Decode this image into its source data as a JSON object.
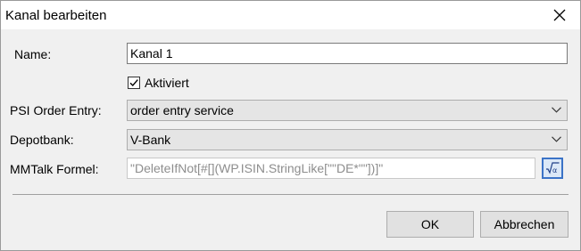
{
  "dialog": {
    "title": "Kanal bearbeiten",
    "close_icon": "close-icon"
  },
  "form": {
    "name_label": "Name:",
    "name_value": "Kanal 1",
    "aktiviert_label": "Aktiviert",
    "aktiviert_checked": true,
    "psi_label": "PSI Order Entry:",
    "psi_value": "order entry service",
    "depotbank_label": "Depotbank:",
    "depotbank_value": "V-Bank",
    "mmtalk_label": "MMTalk Formel:",
    "mmtalk_value": "\"DeleteIfNot[#[](WP.ISIN.StringLike[\"\"DE*\"\"])]\"",
    "formula_icon": "formula-editor-icon"
  },
  "buttons": {
    "ok_label": "OK",
    "cancel_label": "Abbrechen"
  }
}
